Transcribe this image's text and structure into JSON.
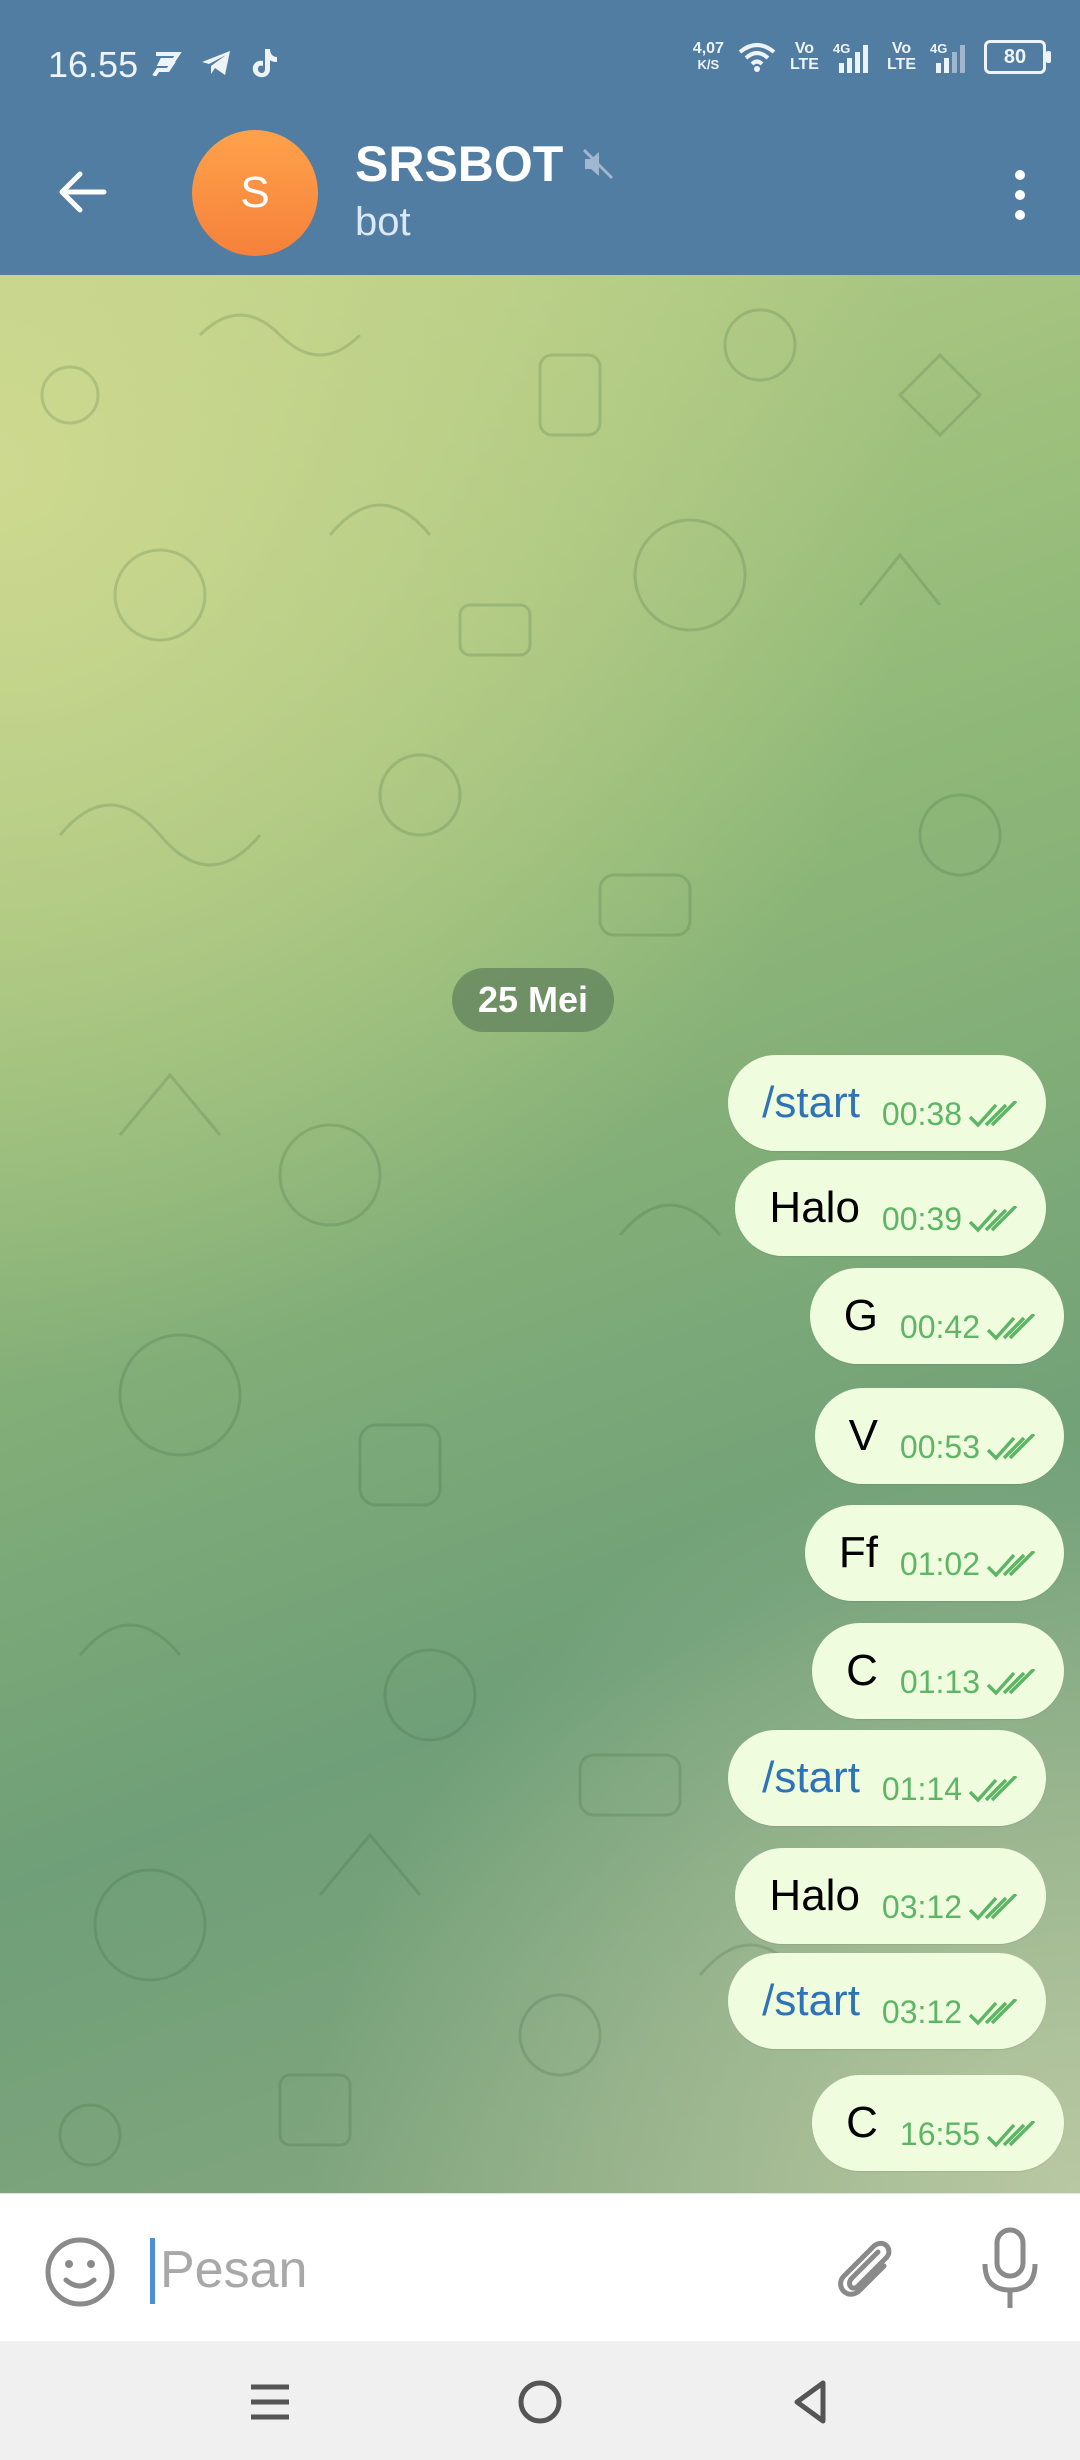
{
  "status_bar": {
    "time": "16.55",
    "speed_value": "4,07",
    "speed_unit": "K/S",
    "network_1": "Vo\nLTE",
    "network_2": "Vo\nLTE",
    "battery": "80"
  },
  "header": {
    "avatar_letter": "S",
    "title": "SRSBOT",
    "subtitle": "bot",
    "avatar_color": "#f7873b",
    "bar_color": "#517da2"
  },
  "chat": {
    "date_label": "25 Mei",
    "messages": [
      {
        "text": "/start",
        "time": "00:38",
        "is_command": true
      },
      {
        "text": "Halo",
        "time": "00:39",
        "is_command": false
      },
      {
        "text": "G",
        "time": "00:42",
        "is_command": false
      },
      {
        "text": "V",
        "time": "00:53",
        "is_command": false
      },
      {
        "text": "Ff",
        "time": "01:02",
        "is_command": false
      },
      {
        "text": "C",
        "time": "01:13",
        "is_command": false
      },
      {
        "text": "/start",
        "time": "01:14",
        "is_command": true
      },
      {
        "text": "Halo",
        "time": "03:12",
        "is_command": false
      },
      {
        "text": "/start",
        "time": "03:12",
        "is_command": true
      },
      {
        "text": "C",
        "time": "16:55",
        "is_command": false
      }
    ]
  },
  "input": {
    "placeholder": "Pesan"
  },
  "colors": {
    "bubble": "#effdde",
    "check": "#5db565",
    "command_text": "#2e73b8"
  }
}
